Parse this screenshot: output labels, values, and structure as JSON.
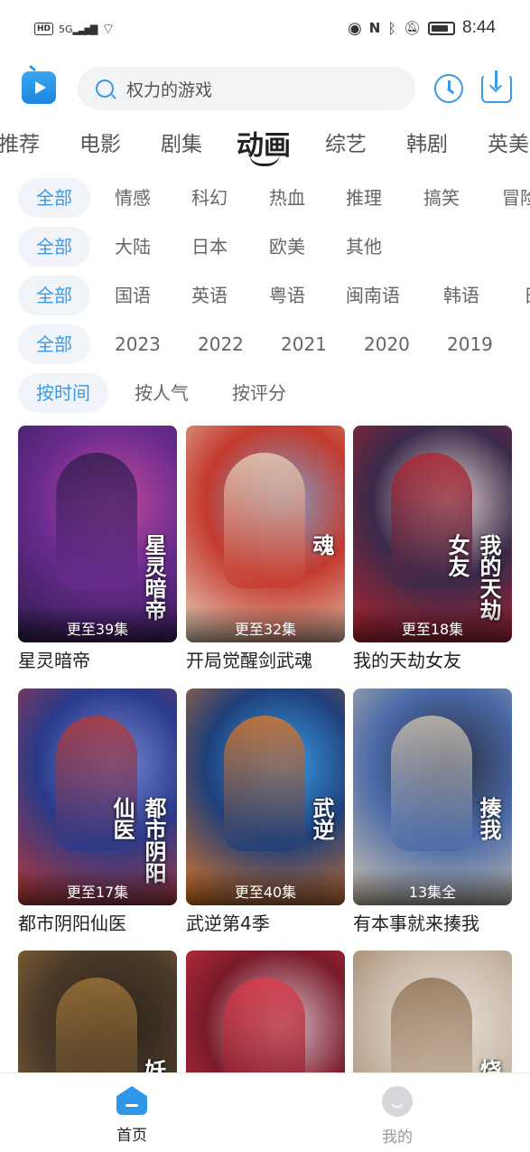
{
  "status_bar": {
    "hd": "HD",
    "signal": "5G",
    "time": "8:44"
  },
  "search": {
    "query": "权力的游戏"
  },
  "category_tabs": [
    "推荐",
    "电影",
    "剧集",
    "动画",
    "综艺",
    "韩剧",
    "英美"
  ],
  "active_category": "动画",
  "filters": [
    [
      "全部",
      "情感",
      "科幻",
      "热血",
      "推理",
      "搞笑",
      "冒险"
    ],
    [
      "全部",
      "大陆",
      "日本",
      "欧美",
      "其他"
    ],
    [
      "全部",
      "国语",
      "英语",
      "粤语",
      "闽南语",
      "韩语",
      "日"
    ],
    [
      "全部",
      "2023",
      "2022",
      "2021",
      "2020",
      "2019"
    ],
    [
      "按时间",
      "按人气",
      "按评分"
    ]
  ],
  "items": [
    {
      "title": "星灵暗帝",
      "badge": "更至39集",
      "cover_text": "星灵暗帝",
      "colors": [
        "#6a2b8f",
        "#2b1d4a",
        "#c04a9a"
      ]
    },
    {
      "title": "开局觉醒剑武魂",
      "badge": "更至32集",
      "cover_text": "魂",
      "colors": [
        "#c43a2e",
        "#e8d8c0",
        "#7fa0c8"
      ]
    },
    {
      "title": "我的天劫女友",
      "badge": "更至18集",
      "cover_text": "我的天劫女友",
      "colors": [
        "#3a2a4a",
        "#b8232c",
        "#e6d4cf"
      ]
    },
    {
      "title": "都市阴阳仙医",
      "badge": "更至17集",
      "cover_text": "都市阴阳仙医",
      "colors": [
        "#2a3a8a",
        "#c0382f",
        "#7a8ad8"
      ]
    },
    {
      "title": "武逆第4季",
      "badge": "更至40集",
      "cover_text": "武逆",
      "colors": [
        "#1f3f7a",
        "#e8781f",
        "#3aa0e8"
      ]
    },
    {
      "title": "有本事就来揍我",
      "badge": "13集全",
      "cover_text": "揍我",
      "colors": [
        "#4a6aa8",
        "#d8c8b0",
        "#2a2a3a"
      ]
    },
    {
      "title": "",
      "badge": "",
      "cover_text": "妖怪正传",
      "colors": [
        "#4a3a2a",
        "#a87a3a",
        "#2a2018"
      ]
    },
    {
      "title": "",
      "badge": "",
      "cover_text": "",
      "colors": [
        "#7a1a2a",
        "#e03a4a",
        "#d8c0c8"
      ]
    },
    {
      "title": "",
      "badge": "",
      "cover_text": "烧烧斗士",
      "colors": [
        "#c8b8a8",
        "#8a6a4a",
        "#e8e0d8"
      ]
    }
  ],
  "bottom_nav": [
    {
      "label": "首页",
      "icon": "home-icon",
      "active": true
    },
    {
      "label": "我的",
      "icon": "profile-icon",
      "active": false
    }
  ],
  "accent_color": "#3a9ae8"
}
